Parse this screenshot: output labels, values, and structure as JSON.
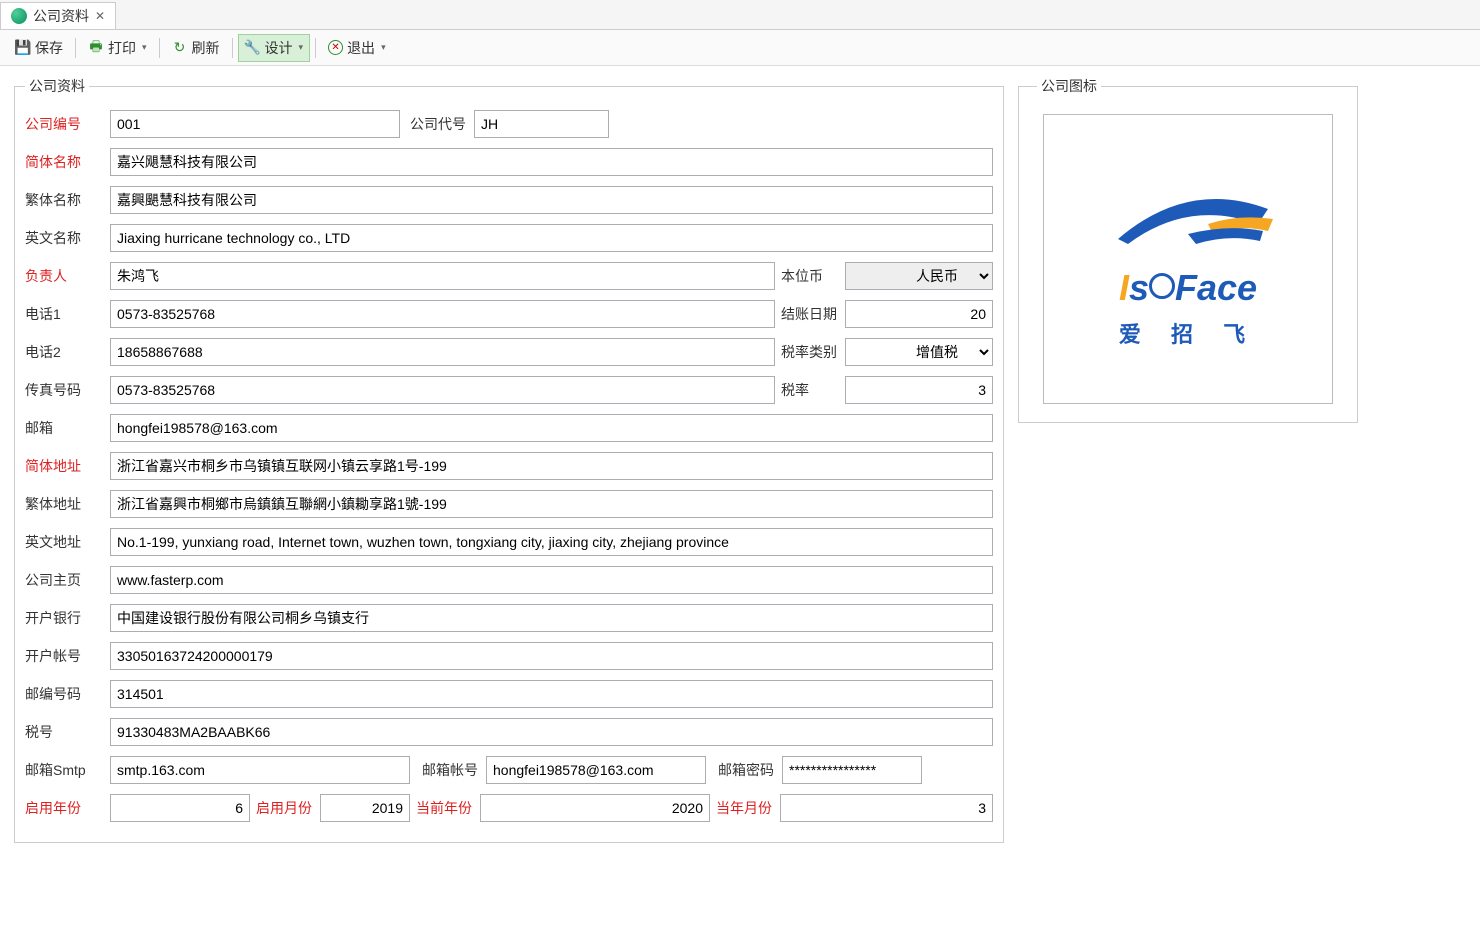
{
  "tab": {
    "title": "公司资料"
  },
  "toolbar": {
    "save": "保存",
    "print": "打印",
    "refresh": "刷新",
    "design": "设计",
    "exit": "退出"
  },
  "groupLeft": "公司资料",
  "groupRight": "公司图标",
  "labels": {
    "companyNo": "公司编号",
    "companyCode": "公司代号",
    "nameSimp": "简体名称",
    "nameTrad": "繁体名称",
    "nameEn": "英文名称",
    "principal": "负责人",
    "baseCurrency": "本位币",
    "phone1": "电话1",
    "closingDate": "结账日期",
    "phone2": "电话2",
    "taxCategory": "税率类别",
    "fax": "传真号码",
    "taxRate": "税率",
    "email": "邮箱",
    "addrSimp": "简体地址",
    "addrTrad": "繁体地址",
    "addrEn": "英文地址",
    "homepage": "公司主页",
    "bank": "开户银行",
    "account": "开户帐号",
    "postcode": "邮编号码",
    "taxNo": "税号",
    "smtp": "邮箱Smtp",
    "emailAccount": "邮箱帐号",
    "emailPwd": "邮箱密码",
    "enableYear": "启用年份",
    "enableMonth": "启用月份",
    "currentYear": "当前年份",
    "currentMonth": "当年月份"
  },
  "values": {
    "companyNo": "001",
    "companyCode": "JH",
    "nameSimp": "嘉兴飓慧科技有限公司",
    "nameTrad": "嘉興颶慧科技有限公司",
    "nameEn": "Jiaxing hurricane technology co., LTD",
    "principal": "朱鸿飞",
    "baseCurrency": "人民币",
    "phone1": "0573-83525768",
    "closingDate": "20",
    "phone2": "18658867688",
    "taxCategory": "增值税",
    "fax": "0573-83525768",
    "taxRate": "3",
    "email": "hongfei198578@163.com",
    "addrSimp": "浙江省嘉兴市桐乡市乌镇镇互联网小镇云享路1号-199",
    "addrTrad": "浙江省嘉興市桐鄉市烏鎮鎮互聯網小鎮耡享路1號-199",
    "addrEn": "No.1-199, yunxiang road, Internet town, wuzhen town, tongxiang city, jiaxing city, zhejiang province",
    "homepage": "www.fasterp.com",
    "bank": "中国建设银行股份有限公司桐乡乌镇支行",
    "account": "33050163724200000179",
    "postcode": "314501",
    "taxNo": "91330483MA2BAABK66",
    "smtp": "smtp.163.com",
    "emailAccount": "hongfei198578@163.com",
    "emailPwd": "****************",
    "enableYear": "6",
    "enableMonth": "2019",
    "currentYear": "2020",
    "currentMonth": "3"
  },
  "logo": {
    "brand": "IsoFace",
    "sub": "爱 招 飞"
  }
}
